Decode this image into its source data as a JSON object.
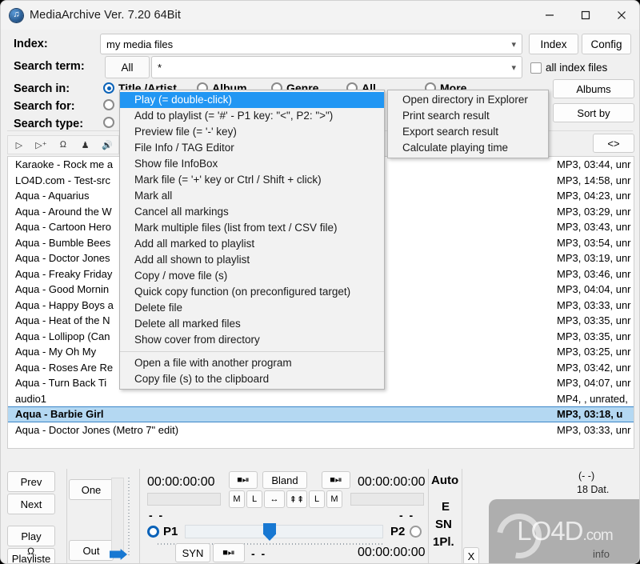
{
  "window": {
    "title": "MediaArchive Ver. 7.20 64Bit",
    "icon": "music-note-icon",
    "minimize": "minimize-icon",
    "maximize": "maximize-icon",
    "close": "close-icon",
    "accent": "#0a62b8",
    "selection_color": "#b4d8f2",
    "menu_highlight": "#2196f3"
  },
  "form": {
    "index_label": "Index:",
    "index_value": "my media files",
    "index_button": "Index",
    "config_button": "Config",
    "search_term_label": "Search term:",
    "search_term_scope": "All",
    "search_term_value": "*",
    "all_index_files": "all index files",
    "search_in_label": "Search in:",
    "search_for_label": "Search for:",
    "search_type_label": "Search type:",
    "search_in_options": [
      "Title /Artist",
      "Album",
      "Genre",
      "All",
      "More"
    ],
    "search_in_selected": "Title /Artist"
  },
  "side": {
    "albums_button": "Albums",
    "sort_by_button": "Sort by",
    "prevnext_button": "<>"
  },
  "toolbar_icons": [
    "play-icon",
    "play-add-icon",
    "headphones-icon",
    "microphone-icon",
    "speaker-icon"
  ],
  "list": {
    "rows": [
      {
        "name": "Karaoke - Rock me a",
        "meta": "MP3, 03:44, unr"
      },
      {
        "name": "LO4D.com - Test-src",
        "meta": "MP3, 14:58, unr"
      },
      {
        "name": "Aqua - Aquarius",
        "meta": "MP3, 04:23, unr"
      },
      {
        "name": "Aqua - Around the W",
        "meta": "MP3, 03:29, unr"
      },
      {
        "name": "Aqua - Cartoon Hero",
        "meta": "MP3, 03:43, unr"
      },
      {
        "name": "Aqua - Bumble Bees",
        "meta": "MP3, 03:54, unr"
      },
      {
        "name": "Aqua - Doctor Jones",
        "meta": "MP3, 03:19, unr"
      },
      {
        "name": "Aqua - Freaky Friday",
        "meta": "MP3, 03:46, unr"
      },
      {
        "name": "Aqua - Good Mornin",
        "meta": "MP3, 04:04, unr"
      },
      {
        "name": "Aqua - Happy Boys a",
        "meta": "MP3, 03:33, unr"
      },
      {
        "name": "Aqua - Heat of the N",
        "meta": "MP3, 03:35, unr"
      },
      {
        "name": "Aqua - Lollipop (Can",
        "meta": "MP3, 03:35, unr"
      },
      {
        "name": "Aqua - My Oh My",
        "meta": "MP3, 03:25, unr"
      },
      {
        "name": "Aqua - Roses Are Re",
        "meta": "MP3, 03:42, unr"
      },
      {
        "name": "Aqua - Turn Back Ti",
        "meta": "MP3, 04:07, unr"
      },
      {
        "name": "audio1",
        "meta": "MP4, , unrated,"
      },
      {
        "name": "Aqua - Barbie Girl",
        "meta": "MP3, 03:18, u",
        "selected": true
      },
      {
        "name": "Aqua - Doctor Jones (Metro 7\" edit)",
        "meta": "MP3, 03:33, unr"
      }
    ]
  },
  "context_menu": {
    "left_items": [
      "Play (= double-click)",
      "Add to playlist (= '#' - P1 key: \"<\", P2: \">\")",
      "Preview file (= '-' key)",
      "File Info / TAG Editor",
      "Show file InfoBox",
      "Mark file (= '+' key or Ctrl / Shift + click)",
      "Mark all",
      "Cancel all markings",
      "Mark multiple files (list from text / CSV file)",
      "Add all marked to playlist",
      "Add all shown to playlist",
      "Copy / move file (s)",
      "Quick copy function (on preconfigured target)",
      "Delete file",
      "Delete all marked files",
      "Show cover from directory",
      "__SEP__",
      "Open a file with another program",
      "Copy file (s) to the clipboard"
    ],
    "highlighted": "Play (= double-click)",
    "right_items": [
      "Open directory in Explorer",
      "Print search result",
      "Export search result",
      "Calculate playing time"
    ]
  },
  "player": {
    "prev": "Prev",
    "next": "Next",
    "play": "Play",
    "playliste": "Playliste",
    "one": "One",
    "out": "Out",
    "p1_time": "00:00:00:00",
    "p2_time": "00:00:00:00",
    "p2_time_bottom": "00:00:00:00",
    "p1_label": "P1",
    "p2_label": "P2",
    "bland_button": "Bland",
    "m_button": "M",
    "l_button": "L",
    "m2_button": "M",
    "l2_button": "L",
    "swap_button": "swap-icon",
    "updown_button": "updown-icon",
    "stop_icon_1": "stop-play-icon",
    "stop_icon_2": "stop-play-icon",
    "stop_icon_3": "stop-play-icon",
    "syn_button": "SYN",
    "headphone_icon": "headphones-icon",
    "dashes_1": "- -",
    "dashes_2": "- -",
    "dashes_3": "- -",
    "auto": "Auto",
    "e": "E",
    "sn": "SN",
    "onepl": "1Pl.",
    "x_button": "X",
    "status_paren": "(- -)",
    "status_count": "18 Dat.",
    "info": "info"
  },
  "watermark": {
    "brand": "LO4D",
    "suffix": ".com"
  }
}
